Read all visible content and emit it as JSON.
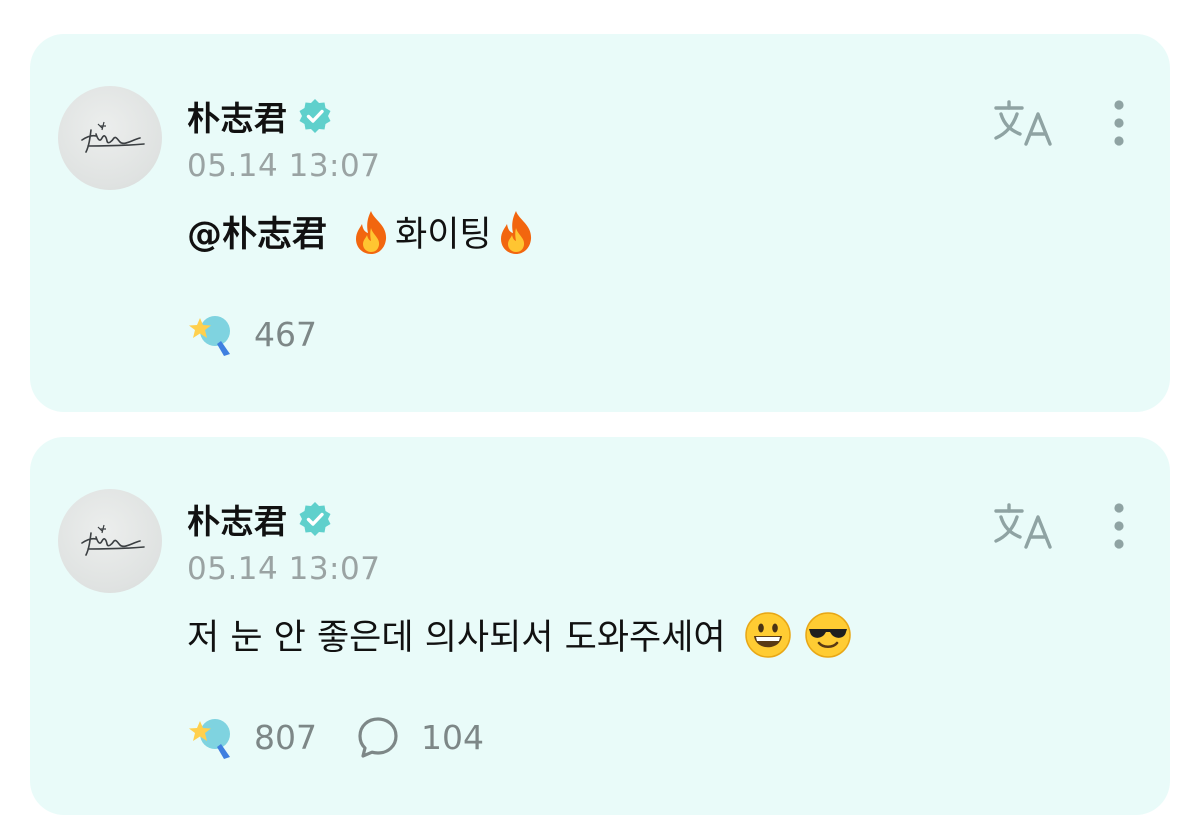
{
  "posts": [
    {
      "author": "朴志君",
      "verified": true,
      "timestamp": "05.14 13:07",
      "content": {
        "mention": "@朴志君",
        "text": "화이팅",
        "emojis": [
          "fire-emoji",
          "fire-emoji"
        ]
      },
      "likes": "467",
      "comments": ""
    },
    {
      "author": "朴志君",
      "verified": true,
      "timestamp": "05.14 13:07",
      "content": {
        "text": "저 눈 안 좋은데 의사되서 도와주세여",
        "emojis": [
          "grinning-face-emoji",
          "sunglasses-face-emoji"
        ]
      },
      "likes": "807",
      "comments": "104"
    }
  ],
  "icons": {
    "verified": "verified-badge-icon",
    "translate": "translate-icon",
    "more": "more-vertical-icon",
    "like": "star-bulb-like-icon",
    "comment": "comment-bubble-icon"
  },
  "colors": {
    "card_background": "#e9fbf9",
    "verified_badge": "#5fd0cc",
    "icon_muted": "#8fa3a3",
    "timestamp": "#9aa3a3",
    "stat_text": "#7d8787"
  }
}
